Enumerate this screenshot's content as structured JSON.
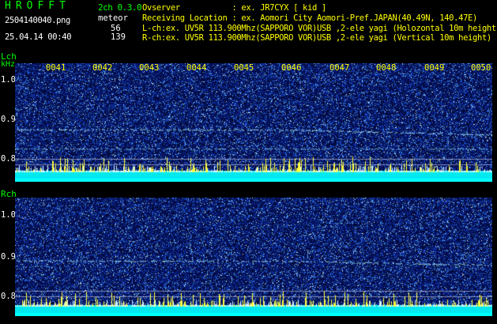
{
  "header": {
    "app_title": "HROFFT",
    "mode": "2ch 0.3.0",
    "filename": "2504140040.png",
    "datetime": "25.04.14 00:40",
    "meteor_label": "meteor",
    "lch_meteor_count": "56",
    "rch_meteor_count": "139"
  },
  "info": {
    "observer": "Ovserver           : ex. JR7CYX [ kid ]",
    "location": "Receiving Location : ex. Aomori City Aomori-Pref.JAPAN(40.49N, 140.47E)",
    "lch": "L-ch:ex. UV5R 113.900Mhz(SAPPORO VOR)USB ,2-ele yagi (Holozontal 10m height)",
    "rch": "R-ch:ex. UV5R 113.900Mhz(SAPPORO VOR)USB ,2-ele yagi (Vertical 10m height)"
  },
  "lch_panel": {
    "channel_label": "Lch",
    "unit_label": "kHz",
    "y_ticks": [
      "1.0",
      "0.9",
      "0.8"
    ]
  },
  "rch_panel": {
    "channel_label": "Rch",
    "y_ticks": [
      "1.0",
      "0.9",
      "0.8"
    ]
  },
  "time_axis": {
    "labels": [
      "0041",
      "0042",
      "0043",
      "0044",
      "0045",
      "0046",
      "0047",
      "0048",
      "0049",
      "0050"
    ]
  },
  "colors": {
    "header_green": "#00ff00",
    "info_yellow": "#ffff00",
    "background": "#000000",
    "spectrogram_base": "#020a3a",
    "baseline_cyan": "#00ffff",
    "meteor_yellow": "#ffff00"
  }
}
